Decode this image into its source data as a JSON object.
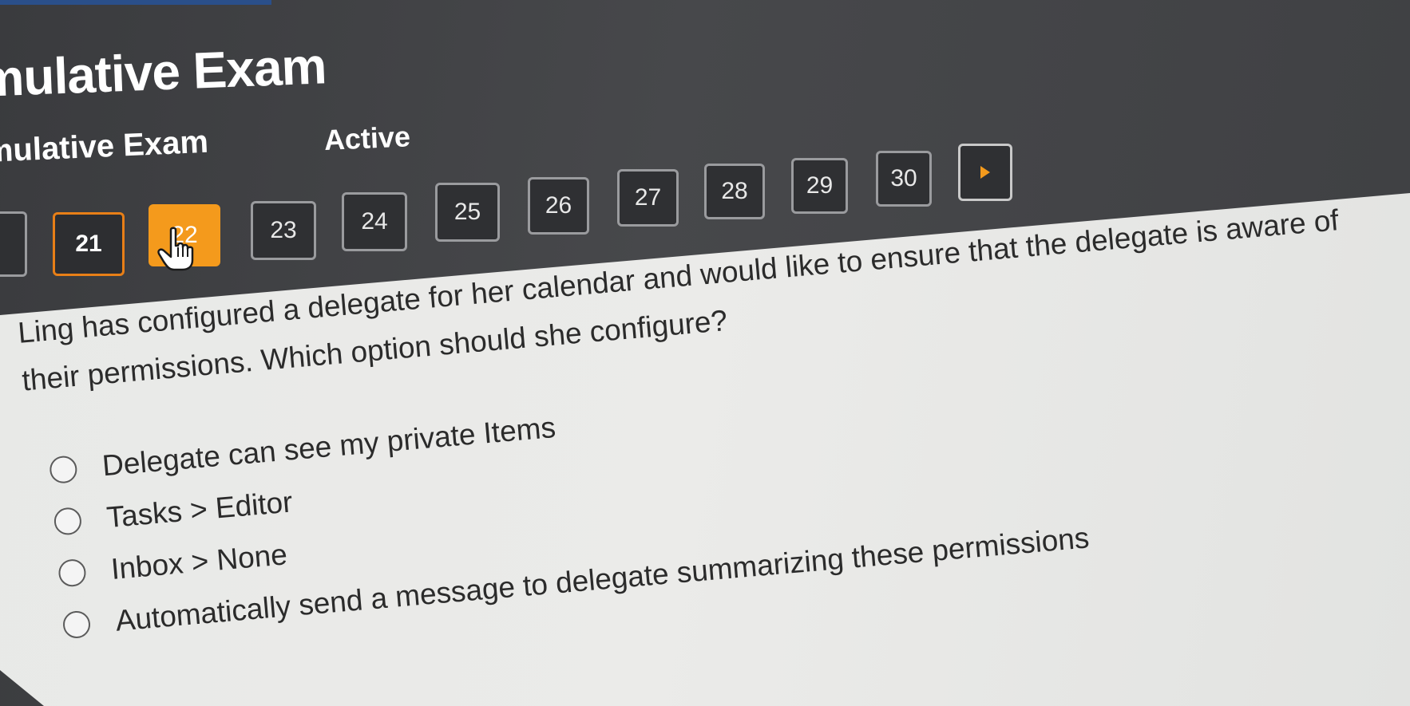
{
  "header": {
    "title": "mulative Exam",
    "subtitle": "mulative Exam",
    "status": "Active"
  },
  "nav": {
    "items": [
      {
        "label": "21",
        "state": "visited"
      },
      {
        "label": "22",
        "state": "current"
      },
      {
        "label": "23",
        "state": "default"
      },
      {
        "label": "24",
        "state": "default"
      },
      {
        "label": "25",
        "state": "default"
      },
      {
        "label": "26",
        "state": "default"
      },
      {
        "label": "27",
        "state": "default"
      },
      {
        "label": "28",
        "state": "default"
      },
      {
        "label": "29",
        "state": "default"
      },
      {
        "label": "30",
        "state": "default"
      }
    ],
    "next_icon": "play-icon",
    "cursor_icon": "hand-pointer-icon"
  },
  "question": {
    "text": "Ling has configured a delegate for her calendar and would like to ensure that the delegate is aware of their permissions. Which option should she configure?",
    "options": [
      {
        "label": "Delegate can see my private Items",
        "selected": false
      },
      {
        "label": "Tasks > Editor",
        "selected": false
      },
      {
        "label": "Inbox > None",
        "selected": false
      },
      {
        "label": "Automatically send a message to delegate summarizing these permissions",
        "selected": false
      }
    ]
  },
  "colors": {
    "accent": "#f49a1c",
    "visited_border": "#e87f17",
    "header_bg": "#434447",
    "panel_bg": "#e8e9e7",
    "text": "#2b2b2b"
  }
}
